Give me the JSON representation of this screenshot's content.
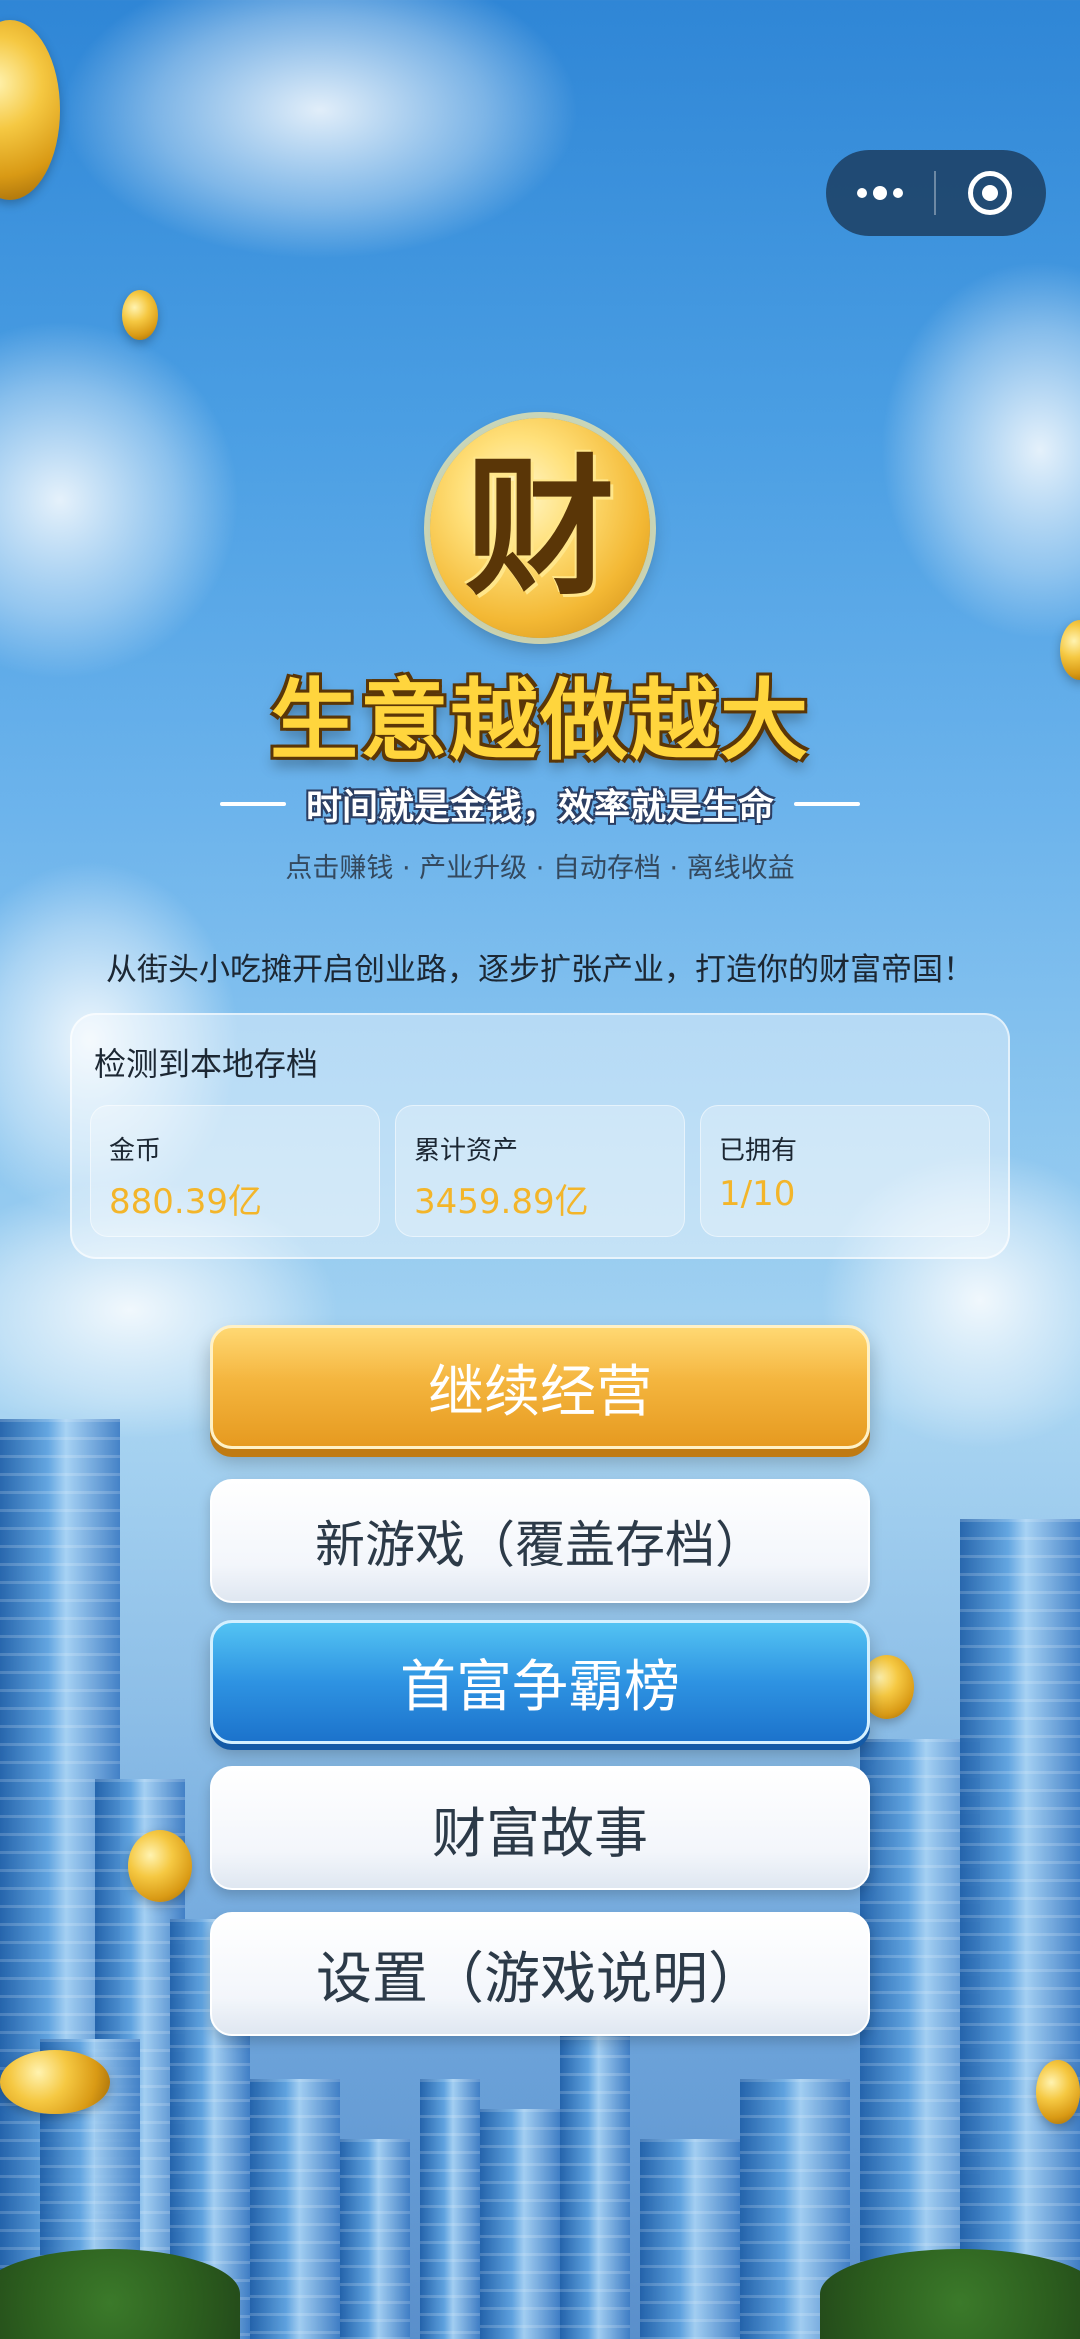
{
  "capsule": {
    "more_icon": "more-dots-icon",
    "close_icon": "target-circle-icon"
  },
  "logo": {
    "character": "财"
  },
  "title": "生意越做越大",
  "slogan": "时间就是金钱，效率就是生命",
  "features": "点击赚钱 · 产业升级 · 自动存档 · 离线收益",
  "intro": "从街头小吃摊开启创业路，逐步扩张产业，打造你的财富帝国！",
  "save": {
    "title": "检测到本地存档",
    "stats": [
      {
        "label": "金币",
        "value": "880.39亿"
      },
      {
        "label": "累计资产",
        "value": "3459.89亿"
      },
      {
        "label": "已拥有",
        "value": "1/10"
      }
    ]
  },
  "buttons": {
    "continue": "继续经营",
    "new_game": "新游戏（覆盖存档）",
    "leaderboard": "首富争霸榜",
    "story": "财富故事",
    "settings": "设置（游戏说明）"
  },
  "colors": {
    "gold": "#f4b53e",
    "blue": "#2e93e2",
    "value": "#f3b52a"
  }
}
